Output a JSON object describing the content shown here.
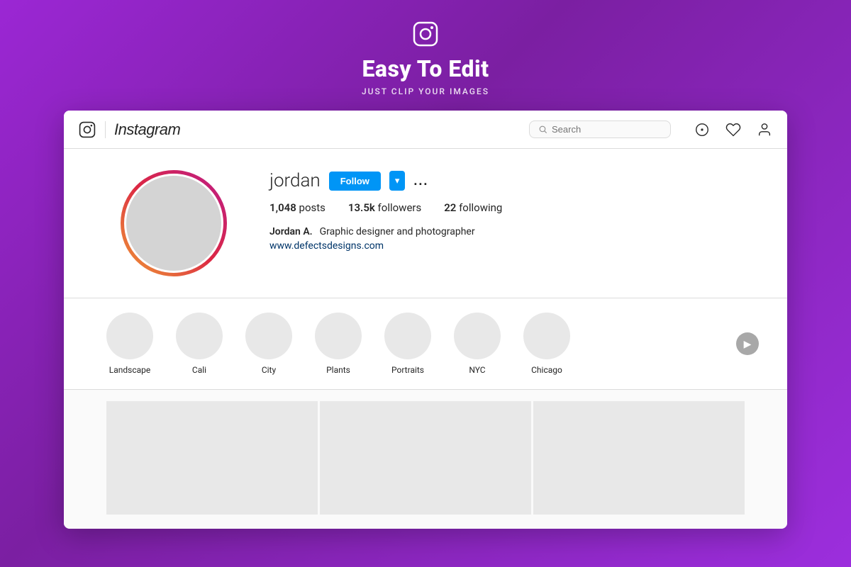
{
  "header": {
    "title": "Easy To Edit",
    "subtitle": "JUST CLIP YOUR IMAGES",
    "icon_label": "instagram-icon"
  },
  "nav": {
    "logo_text": "Instagram",
    "search_placeholder": "Search",
    "icons": [
      "compass-icon",
      "heart-icon",
      "user-icon"
    ]
  },
  "profile": {
    "username": "jordan",
    "follow_label": "Follow",
    "dropdown_arrow": "▾",
    "more_label": "...",
    "stats": {
      "posts_count": "1,048",
      "posts_label": "posts",
      "followers_count": "13.5k",
      "followers_label": "followers",
      "following_count": "22",
      "following_label": "following"
    },
    "bio": {
      "name": "Jordan A.",
      "description": "Graphic designer and photographer",
      "link": "www.defectsdesigns.com"
    }
  },
  "stories": [
    {
      "label": "Landscape"
    },
    {
      "label": "Cali"
    },
    {
      "label": "City"
    },
    {
      "label": "Plants"
    },
    {
      "label": "Portraits"
    },
    {
      "label": "NYC"
    },
    {
      "label": "Chicago"
    }
  ],
  "grid": {
    "items": [
      1,
      2,
      3
    ]
  },
  "colors": {
    "follow_btn_bg": "#0095f6",
    "link_color": "#003569",
    "purple_bg": "#9b27d4"
  }
}
